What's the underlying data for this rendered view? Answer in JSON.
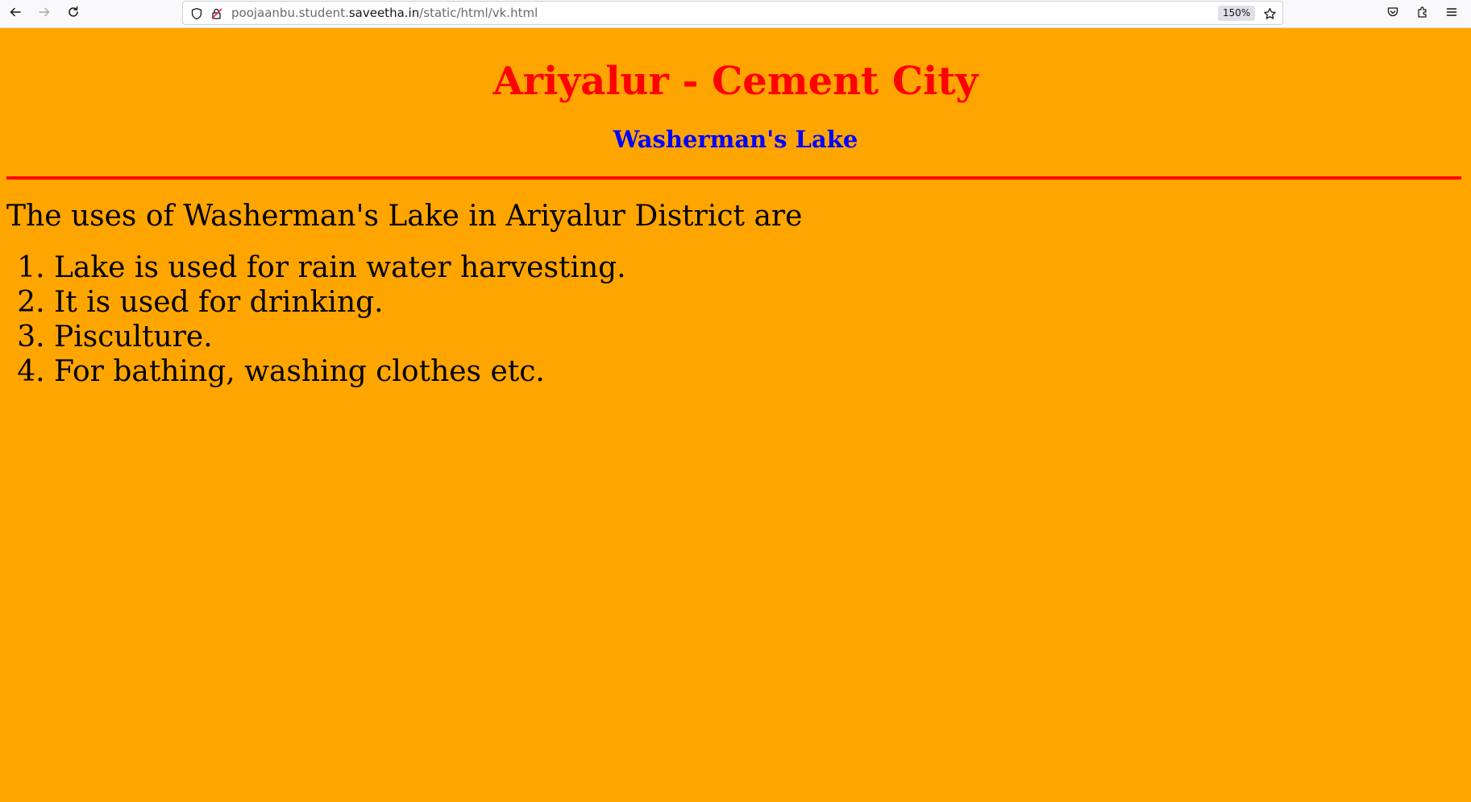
{
  "browser": {
    "url_prefix": "poojaanbu.student.",
    "url_host": "saveetha.in",
    "url_path": "/static/html/vk.html",
    "zoom": "150%",
    "icons": [
      "back-arrow-icon",
      "forward-arrow-icon",
      "reload-icon",
      "shield-icon",
      "insecure-lock-icon",
      "bookmark-star-icon",
      "pocket-icon",
      "extensions-icon",
      "menu-icon"
    ]
  },
  "page": {
    "background": "#ffa500",
    "title": "Ariyalur - Cement City",
    "title_color": "#ff0000",
    "subtitle": "Washerman's Lake",
    "subtitle_color": "#0000ff",
    "rule_color": "#ff0000",
    "intro": "The uses of Washerman's Lake in Ariyalur District are",
    "uses": [
      {
        "num": "1.",
        "text": "Lake is used for rain water harvesting."
      },
      {
        "num": "2.",
        "text": "It is used for drinking."
      },
      {
        "num": "3.",
        "text": "Pisculture."
      },
      {
        "num": "4.",
        "text": "For bathing, washing clothes etc."
      }
    ]
  }
}
